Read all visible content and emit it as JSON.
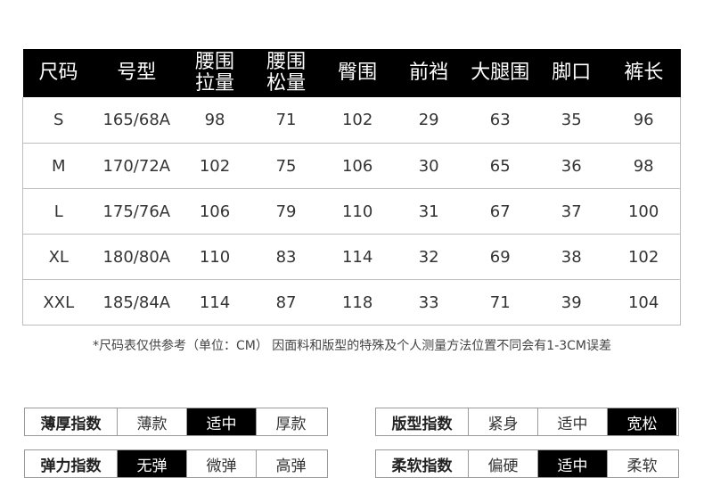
{
  "size_table": {
    "headers": [
      {
        "l1": "尺码",
        "l2": ""
      },
      {
        "l1": "号型",
        "l2": ""
      },
      {
        "l1": "腰围",
        "l2": "拉量"
      },
      {
        "l1": "腰围",
        "l2": "松量"
      },
      {
        "l1": "臀围",
        "l2": ""
      },
      {
        "l1": "前裆",
        "l2": ""
      },
      {
        "l1": "大腿围",
        "l2": ""
      },
      {
        "l1": "脚口",
        "l2": ""
      },
      {
        "l1": "裤长",
        "l2": ""
      }
    ],
    "rows": [
      [
        "S",
        "165/68A",
        "98",
        "71",
        "102",
        "29",
        "63",
        "35",
        "96"
      ],
      [
        "M",
        "170/72A",
        "102",
        "75",
        "106",
        "30",
        "65",
        "36",
        "98"
      ],
      [
        "L",
        "175/76A",
        "106",
        "79",
        "110",
        "31",
        "67",
        "37",
        "100"
      ],
      [
        "XL",
        "180/80A",
        "110",
        "83",
        "114",
        "32",
        "69",
        "38",
        "102"
      ],
      [
        "XXL",
        "185/84A",
        "114",
        "87",
        "118",
        "33",
        "71",
        "39",
        "104"
      ]
    ]
  },
  "note": "*尺码表仅供参考（单位：CM） 因面料和版型的特殊及个人测量方法位置不同会有1-3CM误差",
  "attributes": [
    {
      "label": "薄厚指数",
      "options": [
        "薄款",
        "适中",
        "厚款"
      ],
      "selected": 1
    },
    {
      "label": "版型指数",
      "options": [
        "紧身",
        "适中",
        "宽松"
      ],
      "selected": 2
    },
    {
      "label": "弹力指数",
      "options": [
        "无弹",
        "微弹",
        "高弹"
      ],
      "selected": 0
    },
    {
      "label": "柔软指数",
      "options": [
        "偏硬",
        "适中",
        "柔软"
      ],
      "selected": 1
    }
  ],
  "colors": {
    "header_bg": "#000000",
    "header_text": "#ffffff",
    "selected_bg": "#000000"
  }
}
